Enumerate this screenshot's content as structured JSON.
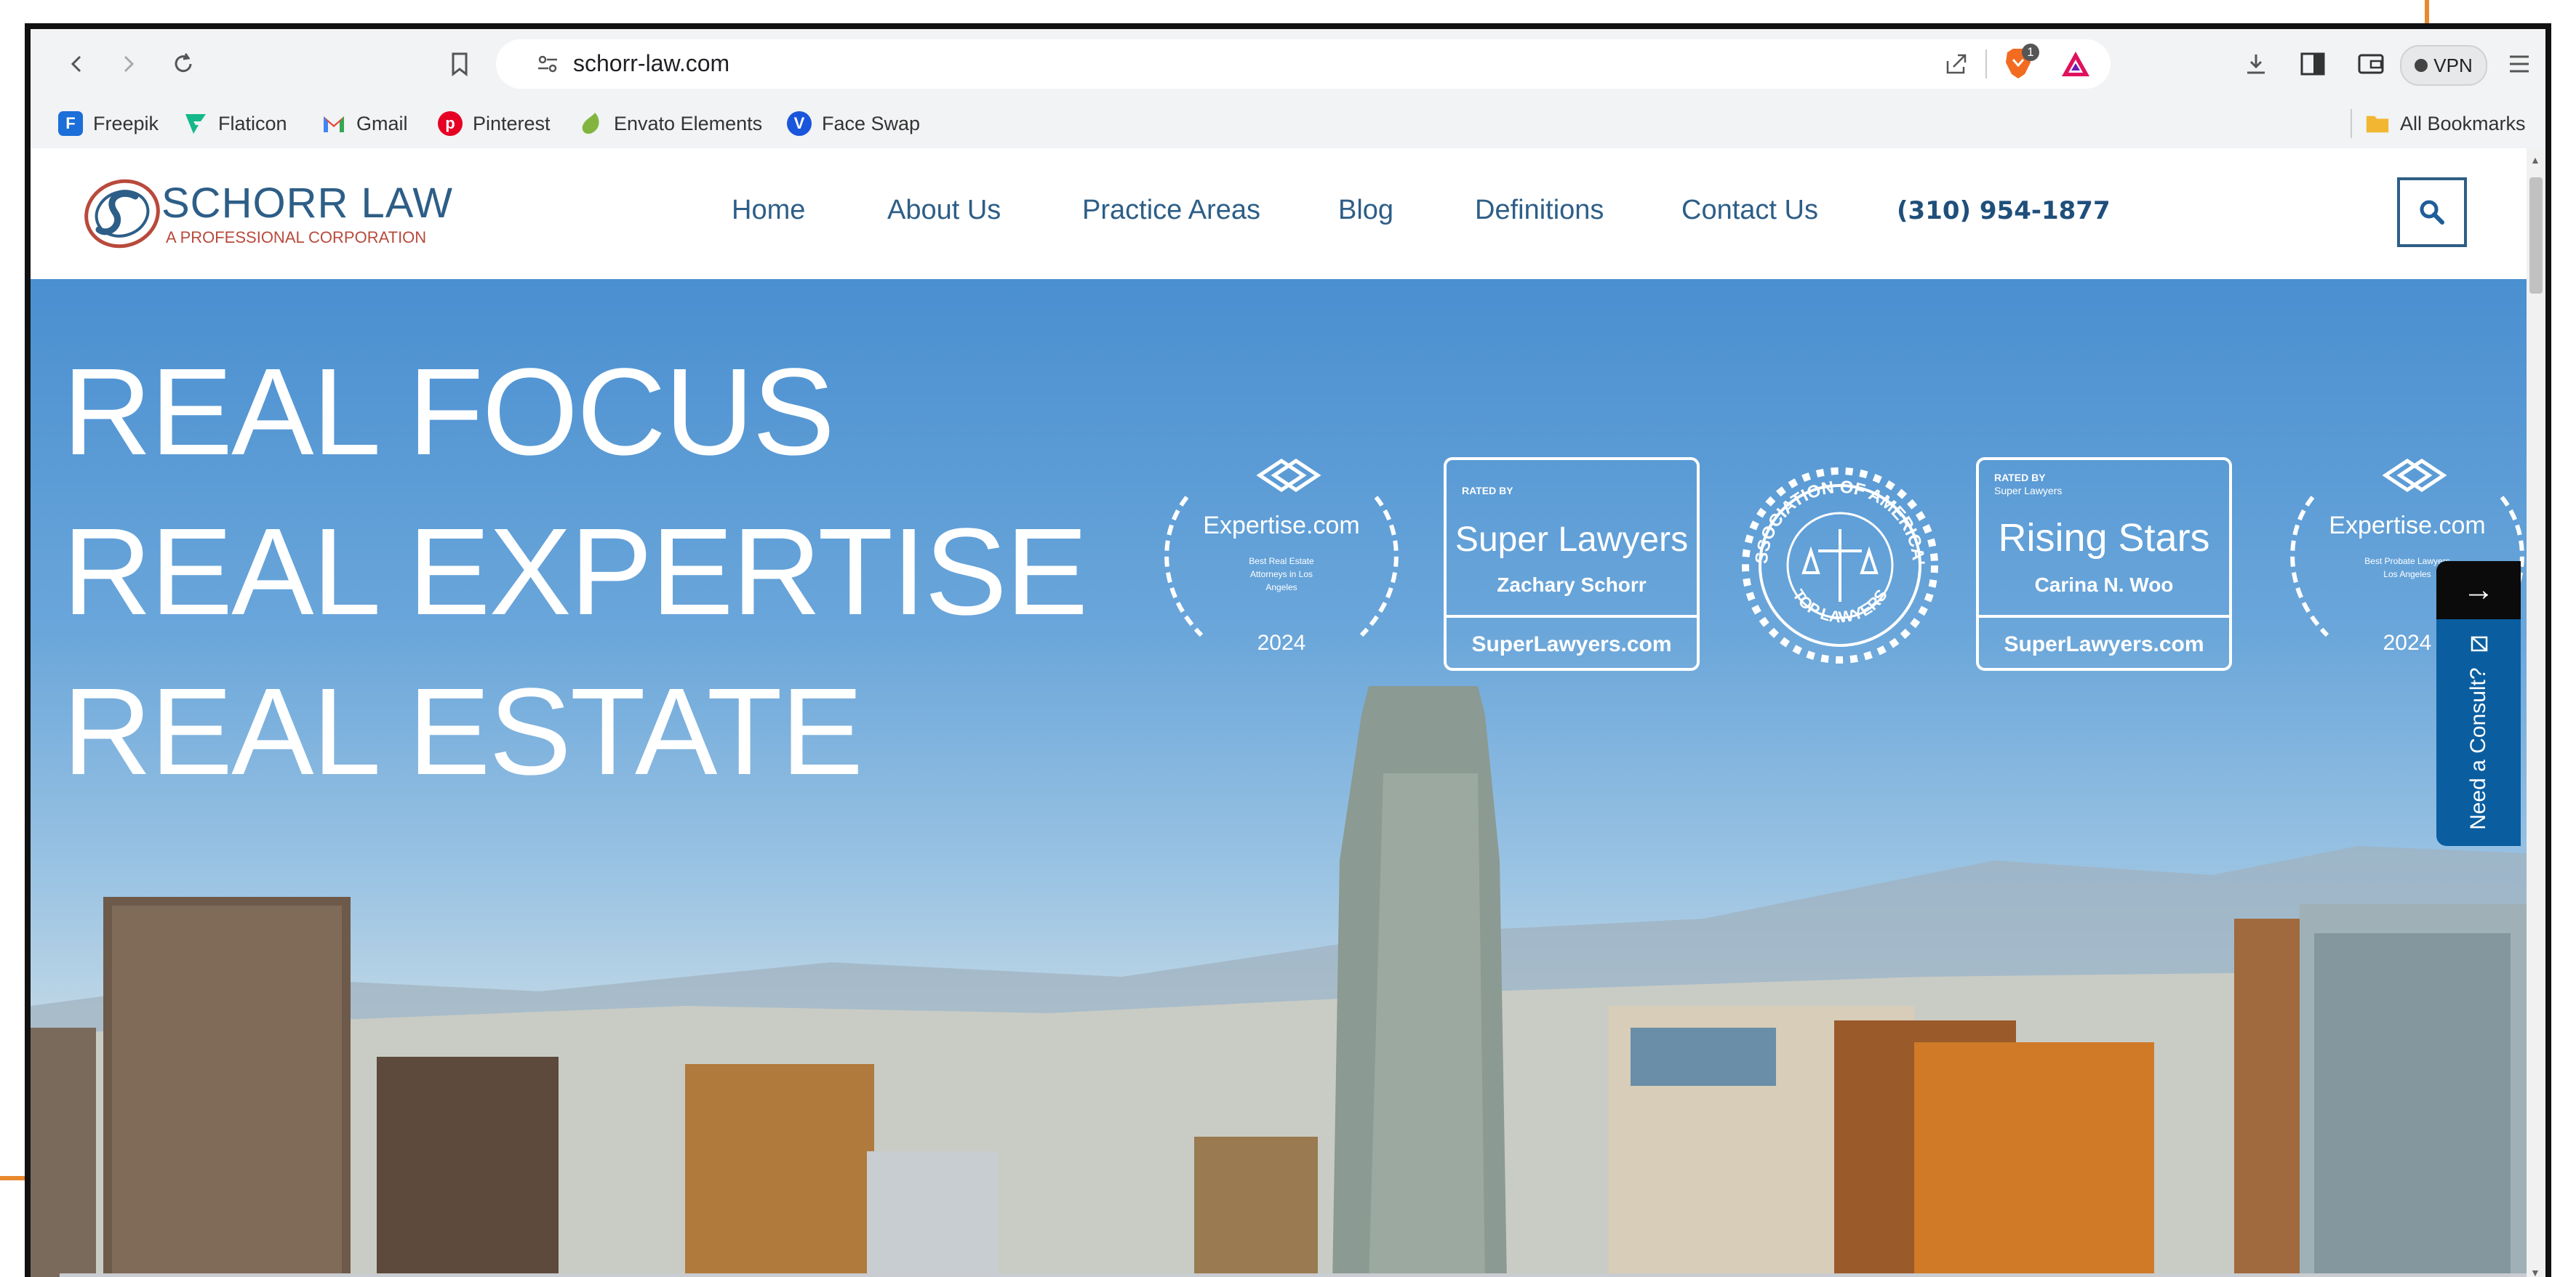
{
  "browser": {
    "url": "schorr-law.com",
    "shield_count": "1",
    "vpn_label": "VPN",
    "bookmarks": [
      {
        "label": "Freepik",
        "icon": "freepik-icon",
        "color": "#1c6ed8"
      },
      {
        "label": "Flaticon",
        "icon": "flaticon-icon",
        "color": "#14b88a"
      },
      {
        "label": "Gmail",
        "icon": "gmail-icon",
        "color": "#ea4335"
      },
      {
        "label": "Pinterest",
        "icon": "pinterest-icon",
        "color": "#e60023"
      },
      {
        "label": "Envato Elements",
        "icon": "envato-icon",
        "color": "#82b540"
      },
      {
        "label": "Face Swap",
        "icon": "faceswap-icon",
        "color": "#1a56db"
      }
    ],
    "all_bookmarks": "All Bookmarks"
  },
  "site": {
    "logo": {
      "name": "SCHORR LAW",
      "tagline": "A PROFESSIONAL CORPORATION",
      "accent": "#b84a3c",
      "primary": "#2d5e87"
    },
    "nav": [
      "Home",
      "About Us",
      "Practice Areas",
      "Blog",
      "Definitions",
      "Contact Us"
    ],
    "phone": "(310) 954-1877",
    "hero": {
      "lines": [
        "REAL FOCUS",
        "REAL EXPERTISE",
        "REAL ESTATE"
      ],
      "badges": [
        {
          "title": "Expertise.com",
          "sub": [
            "Best Real Estate",
            "Attorneys in Los",
            "Angeles"
          ],
          "year": "2024"
        },
        {
          "rated": "RATED BY",
          "title": "Super Lawyers",
          "name": "Zachary Schorr",
          "site": "SuperLawyers.com"
        },
        {
          "title": "ASSOCIATION OF AMERICA'S",
          "bottom": "TOP LAWYERS"
        },
        {
          "rated": "RATED BY",
          "rated2": "Super Lawyers",
          "title": "Rising Stars",
          "name": "Carina N. Woo",
          "site": "SuperLawyers.com"
        },
        {
          "title": "Expertise.com",
          "sub": [
            "Best Probate Lawyers",
            "Los Angeles"
          ],
          "year": "2024"
        }
      ]
    },
    "consult": {
      "label": "Need a Consult?",
      "arrow": "→"
    }
  },
  "colors": {
    "chrome": "#f1f3f4",
    "nav_text": "#2d5e87",
    "consult": "#0a5ea0",
    "frame": "#111111",
    "annotation": "#e8892e"
  }
}
